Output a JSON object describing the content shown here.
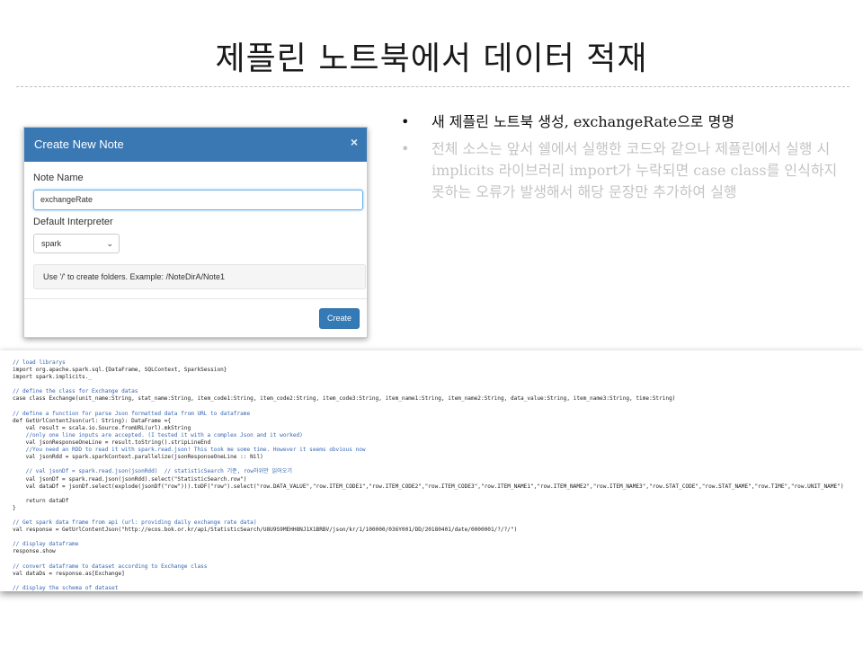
{
  "slide": {
    "title": "제플린 노트북에서 데이터 적재"
  },
  "modal": {
    "header_title": "Create New Note",
    "close_glyph": "×",
    "note_name_label": "Note Name",
    "note_name_value": "exchangeRate",
    "default_interpreter_label": "Default Interpreter",
    "interpreter_selected": "spark",
    "chevron_glyph": "⌄",
    "help_text": "Use '/' to create folders. Example: /NoteDirA/Note1",
    "create_button_label": "Create",
    "colors": {
      "header": "#3a78b4",
      "button": "#337ab7"
    }
  },
  "bullets": {
    "dot": "•",
    "items": [
      {
        "text": "새 제플린 노트북 생성, exchangeRate으로 명명"
      },
      {
        "text": "전체 소스는 앞서 쉘에서 실행한 코드와 같으나 제플린에서 실행 시 implicits 라이브러리 import가 누락되면 case class를 인식하지 못하는 오류가 발생해서 해당 문장만 추가하여 실행"
      }
    ]
  },
  "code": {
    "lines": [
      {
        "kind": "comment",
        "text": "// load librarys"
      },
      {
        "kind": "plain",
        "text": "import org.apache.spark.sql.{DataFrame, SQLContext, SparkSession}"
      },
      {
        "kind": "plain",
        "text": "import spark.implicits._"
      },
      {
        "kind": "plain",
        "text": ""
      },
      {
        "kind": "comment",
        "text": "// define the class for Exchange datas"
      },
      {
        "kind": "plain",
        "text": "case class Exchange(unit_name:String, stat_name:String, item_code1:String, item_code2:String, item_code3:String, item_name1:String, item_name2:String, data_value:String, item_name3:String, time:String)"
      },
      {
        "kind": "plain",
        "text": ""
      },
      {
        "kind": "comment",
        "text": "// define a function for parse Json formatted data from URL to dataframe"
      },
      {
        "kind": "plain",
        "text": "def GetUrlContentJson(url: String): DataFrame ={"
      },
      {
        "kind": "plain",
        "text": "    val result = scala.io.Source.fromURL(url).mkString"
      },
      {
        "kind": "comment",
        "text": "    //only one line inputs are accepted. (I tested it with a complex Json and it worked)"
      },
      {
        "kind": "plain",
        "text": "    val jsonResponseOneLine = result.toString().stripLineEnd"
      },
      {
        "kind": "comment",
        "text": "    //You need an RDD to read it with spark.read.json! This took me some time. However it seems obvious now"
      },
      {
        "kind": "plain",
        "text": "    val jsonRdd = spark.sparkContext.parallelize(jsonResponseOneLine :: Nil)"
      },
      {
        "kind": "plain",
        "text": ""
      },
      {
        "kind": "comment",
        "text": "    // val jsonDf = spark.read.json(jsonRdd)  // statisticSearch 기준, row하위만 읽어오기"
      },
      {
        "kind": "plain",
        "text": "    val jsonDf = spark.read.json(jsonRdd).select(\"StatisticSearch.row\")"
      },
      {
        "kind": "plain",
        "text": "    val dataDf = jsonDf.select(explode(jsonDf(\"row\"))).toDF(\"row\").select(\"row.DATA_VALUE\",\"row.ITEM_CODE1\",\"row.ITEM_CODE2\",\"row.ITEM_CODE3\",\"row.ITEM_NAME1\",\"row.ITEM_NAME2\",\"row.ITEM_NAME3\",\"row.STAT_CODE\",\"row.STAT_NAME\",\"row.TIME\",\"row.UNIT_NAME\")"
      },
      {
        "kind": "plain",
        "text": ""
      },
      {
        "kind": "plain",
        "text": "    return dataDf"
      },
      {
        "kind": "plain",
        "text": "}"
      },
      {
        "kind": "plain",
        "text": ""
      },
      {
        "kind": "comment",
        "text": "// Get spark data frame from api (url: providing daily exchange rate data)"
      },
      {
        "kind": "plain",
        "text": "val response = GetUrlContentJson(\"http://ecos.bok.or.kr/api/StatisticSearch/U8U9S9MEHH8NJ1X1BRBV/json/kr/1/100000/036Y001/DD/20180401/date/0000001/?/?/\")"
      },
      {
        "kind": "plain",
        "text": ""
      },
      {
        "kind": "comment",
        "text": "// display dataframe"
      },
      {
        "kind": "plain",
        "text": "response.show"
      },
      {
        "kind": "plain",
        "text": ""
      },
      {
        "kind": "comment",
        "text": "// convert dataframe to dataset according to Exchange class"
      },
      {
        "kind": "plain",
        "text": "val dataDs = response.as[Exchange]"
      },
      {
        "kind": "plain",
        "text": ""
      },
      {
        "kind": "comment",
        "text": "// display the schema of dataset"
      }
    ]
  }
}
